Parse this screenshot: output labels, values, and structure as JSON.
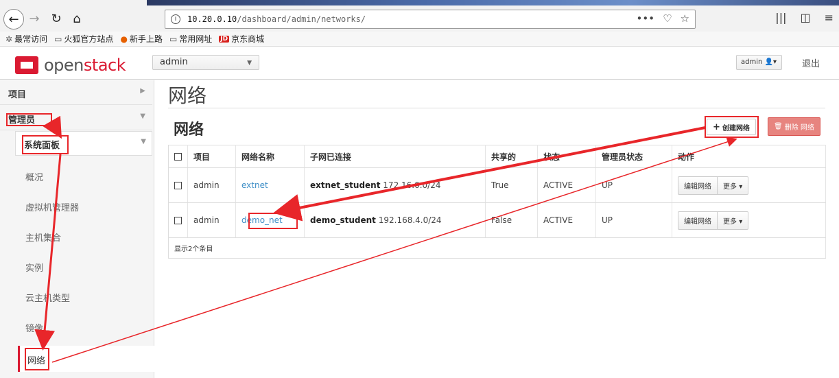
{
  "browser": {
    "url_host": "10.20.0.10",
    "url_path": "/dashboard/admin/networks/",
    "bookmarks": [
      {
        "label": "最常访问",
        "icon": "gear-icon"
      },
      {
        "label": "火狐官方站点",
        "icon": "folder-icon"
      },
      {
        "label": "新手上路",
        "icon": "firefox-icon"
      },
      {
        "label": "常用网址",
        "icon": "folder-icon"
      },
      {
        "label": "京东商城",
        "icon": "jd-icon"
      }
    ]
  },
  "header": {
    "logo_open": "open",
    "logo_stack": "stack",
    "project": "admin",
    "user": "admin",
    "logout": "退出"
  },
  "sidebar": {
    "project": "项目",
    "admin": "管理员",
    "system_panel": "系统面板",
    "items": [
      "概况",
      "虚拟机管理器",
      "主机集合",
      "实例",
      "云主机类型",
      "镜像"
    ],
    "active": "网络"
  },
  "main": {
    "page_title": "网络",
    "section_title": "网络",
    "create_button": "创建网络",
    "delete_button": "删除 网络",
    "columns": [
      "项目",
      "网络名称",
      "子网已连接",
      "共享的",
      "状态",
      "管理员状态",
      "动作"
    ],
    "rows": [
      {
        "project": "admin",
        "name": "extnet",
        "subnet_name": "extnet_student",
        "subnet_cidr": "172.16.0.0/24",
        "shared": "True",
        "status": "ACTIVE",
        "admin_state": "UP",
        "edit": "编辑网络",
        "more": "更多"
      },
      {
        "project": "admin",
        "name": "demo_net",
        "subnet_name": "demo_student",
        "subnet_cidr": "192.168.4.0/24",
        "shared": "False",
        "status": "ACTIVE",
        "admin_state": "UP",
        "edit": "编辑网络",
        "more": "更多"
      }
    ],
    "footer": "显示2个条目"
  },
  "colors": {
    "accent": "#da1a32",
    "annotation": "#e8262a",
    "link": "#3f8fc7",
    "danger": "#d9534f"
  }
}
